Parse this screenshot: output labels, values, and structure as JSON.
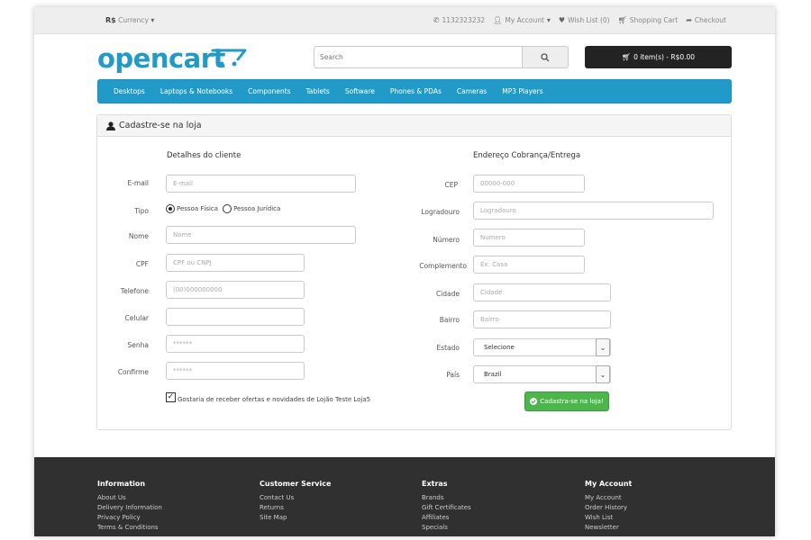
{
  "topbar": {
    "currency_symbol": "R$",
    "currency_label": "Currency",
    "phone": "1132323232",
    "my_account": "My Account",
    "wishlist": "Wish List (0)",
    "shopping_cart": "Shopping Cart",
    "checkout": "Checkout"
  },
  "header": {
    "logo": "opencart",
    "search_placeholder": "Search",
    "cart": "0 item(s) - R$0.00"
  },
  "menu": [
    "Desktops",
    "Laptops & Notebooks",
    "Components",
    "Tablets",
    "Software",
    "Phones & PDAs",
    "Cameras",
    "MP3 Players"
  ],
  "panel": {
    "title": "Cadastre-se na loja",
    "left_title": "Detalhes do cliente",
    "right_title": "Endereço Cobrança/Entrega",
    "left": {
      "email_label": "E-mail",
      "email_ph": "E-mail",
      "tipo_label": "Tipo",
      "pf": "Pessoa Física",
      "pj": "Pessoa Jurídica",
      "nome_label": "Nome",
      "nome_ph": "Nome",
      "cpf_label": "CPF",
      "cpf_ph": "CPF ou CNPJ",
      "tel_label": "Telefone",
      "tel_ph": "(00)000000000",
      "cel_label": "Celular",
      "cel_ph": "",
      "senha_label": "Senha",
      "senha_ph": "******",
      "conf_label": "Confirme",
      "conf_ph": "******",
      "newsletter": "Gostaria de receber ofertas e novidades de Lojão Teste Loja5"
    },
    "right": {
      "cep_label": "CEP",
      "cep_ph": "00000-000",
      "log_label": "Logradouro",
      "log_ph": "Logradouro",
      "num_label": "Número",
      "num_ph": "Numero",
      "comp_label": "Complemento",
      "comp_ph": "Ex: Casa",
      "cid_label": "Cidade",
      "cid_ph": "Cidade",
      "bai_label": "Bairro",
      "bai_ph": "Bairro",
      "est_label": "Estado",
      "est_val": "Selecione",
      "pais_label": "País",
      "pais_val": "Brazil"
    },
    "submit": "Cadastra-se na loja!"
  },
  "footer": {
    "info": {
      "title": "Information",
      "links": [
        "About Us",
        "Delivery Information",
        "Privacy Policy",
        "Terms & Conditions"
      ]
    },
    "service": {
      "title": "Customer Service",
      "links": [
        "Contact Us",
        "Returns",
        "Site Map"
      ]
    },
    "extras": {
      "title": "Extras",
      "links": [
        "Brands",
        "Gift Certificates",
        "Affiliates",
        "Specials"
      ]
    },
    "account": {
      "title": "My Account",
      "links": [
        "My Account",
        "Order History",
        "Wish List",
        "Newsletter"
      ]
    }
  },
  "colors": {
    "brand": "#229ac8",
    "dark": "#232323",
    "success": "#4cb64c",
    "footer": "#303030"
  }
}
